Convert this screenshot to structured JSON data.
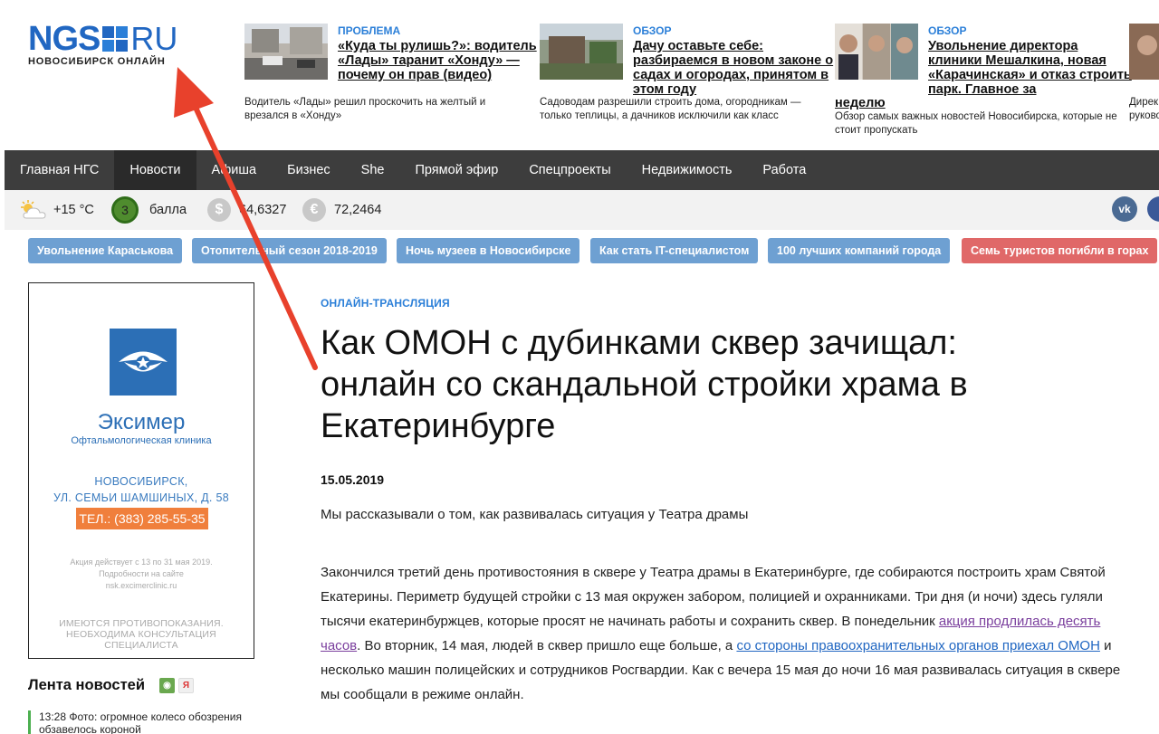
{
  "logo": {
    "main": "NGS",
    "ru": "RU",
    "subtitle": "НОВОСИБИРСК ОНЛАЙН"
  },
  "teasers": [
    {
      "rubric": "ПРОБЛЕМА",
      "headline": "«Куда ты рулишь?»: водитель «Лады» таранит «Хонду» — почему он прав (видео)",
      "lead": "Водитель «Лады» решил проскочить на желтый и врезался в «Хонду»"
    },
    {
      "rubric": "ОБЗОР",
      "headline": "Дачу оставьте себе: разбираемся в новом законе о садах и огородах, принятом в этом году",
      "lead": "Садоводам разрешили строить дома, огородникам — только теплицы, а дачников исключили как класс"
    },
    {
      "rubric": "ОБЗОР",
      "headline": "Увольнение директора клиники Мешалкина, новая «Карачинская» и отказ строить парк. Главное за",
      "headline_tail": "неделю",
      "lead": "Обзор самых важных новостей Новосибирска, которые не стоит пропускать"
    },
    {
      "lead": "Дирек руково"
    }
  ],
  "nav": [
    "Главная НГС",
    "Новости",
    "Афиша",
    "Бизнес",
    "She",
    "Прямой эфир",
    "Спецпроекты",
    "Недвижимость",
    "Работа"
  ],
  "infobar": {
    "temperature": "+15 °C",
    "magnetic_value": "3",
    "magnetic_label": "балла",
    "usd_symbol": "$",
    "usd": "64,6327",
    "eur_symbol": "€",
    "eur": "72,2464",
    "vk": "vk"
  },
  "tags": [
    "Увольнение Караськова",
    "Отопительный сезон 2018-2019",
    "Ночь музеев в Новосибирске",
    "Как стать IT-специалистом",
    "100 лучших компаний города",
    "Семь туристов погибли в горах"
  ],
  "ad": {
    "brand": "Эксимер",
    "subtitle": "Офтальмологическая клиника",
    "city": "НОВОСИБИРСК,",
    "address": "УЛ. СЕМЬИ ШАМШИНЫХ, Д. 58",
    "phone": "ТЕЛ.: (383) 285-55-35",
    "promo": [
      "Акция действует с 13 по 31 мая 2019.",
      "Подробности на сайте",
      "nsk.excimerclinic.ru"
    ],
    "warning": [
      "ИМЕЮТСЯ ПРОТИВОПОКАЗАНИЯ.",
      "НЕОБХОДИМА КОНСУЛЬТАЦИЯ",
      "СПЕЦИАЛИСТА"
    ]
  },
  "feed": {
    "title": "Лента новостей",
    "items": [
      {
        "time": "13:28",
        "text": "Фото: огромное колесо обозрения обзавелось короной"
      }
    ]
  },
  "article": {
    "rubric": "ОНЛАЙН-ТРАНСЛЯЦИЯ",
    "title": "Как ОМОН с дубинками сквер зачищал: онлайн со скандальной стройки храма в Екатеринбурге",
    "date": "15.05.2019",
    "lead": "Мы рассказывали о том, как развивалась ситуация у Театра драмы",
    "body_1": "Закончился третий день противостояния в сквере у Театра драмы в Екатеринбурге, где собираются построить храм Святой Екатерины. Периметр будущей стройки с 13 мая окружен забором, полицией и охранниками. Три дня (и ночи) здесь гуляли тысячи екатеринбуржцев, которые просят не начинать работы и сохранить сквер. В понедельник ",
    "link_1": "акция продлилась десять часов",
    "body_2": ". Во вторник, 14 мая, людей в сквер пришло еще больше, а ",
    "link_2": "со стороны правоохранительных органов приехал ОМОН",
    "body_3": " и несколько машин полицейских и сотрудников Росгвардии. Как с вечера 15 мая до ночи 16 мая развивалась ситуация в сквере мы сообщали в режиме онлайн."
  },
  "colors": {
    "brand": "#2167c2",
    "nav_bg": "#3d3d3d",
    "tag": "#6ea0d2",
    "tag_alert": "#e06868",
    "arrow": "#e8412c"
  }
}
